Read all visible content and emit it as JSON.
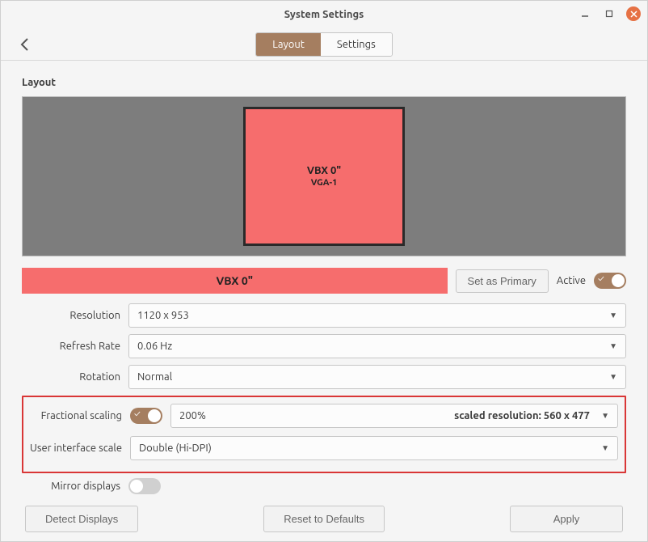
{
  "window": {
    "title": "System Settings"
  },
  "tabs": {
    "layout": "Layout",
    "settings": "Settings"
  },
  "section": {
    "label": "Layout"
  },
  "display": {
    "name": "VBX 0\"",
    "port": "VGA-1",
    "selected_name": "VBX 0\"",
    "set_primary": "Set as Primary",
    "active_label": "Active"
  },
  "fields": {
    "resolution": {
      "label": "Resolution",
      "value": "1120 x 953"
    },
    "refresh": {
      "label": "Refresh Rate",
      "value": "0.06 Hz"
    },
    "rotation": {
      "label": "Rotation",
      "value": "Normal"
    },
    "fractional": {
      "label": "Fractional scaling",
      "value": "200%",
      "scaled_label": "scaled resolution:",
      "scaled_value": "560 x 477"
    },
    "uiscale": {
      "label": "User interface scale",
      "value": "Double (Hi-DPI)"
    },
    "mirror": {
      "label": "Mirror displays"
    }
  },
  "buttons": {
    "detect": "Detect Displays",
    "reset": "Reset to Defaults",
    "apply": "Apply"
  }
}
